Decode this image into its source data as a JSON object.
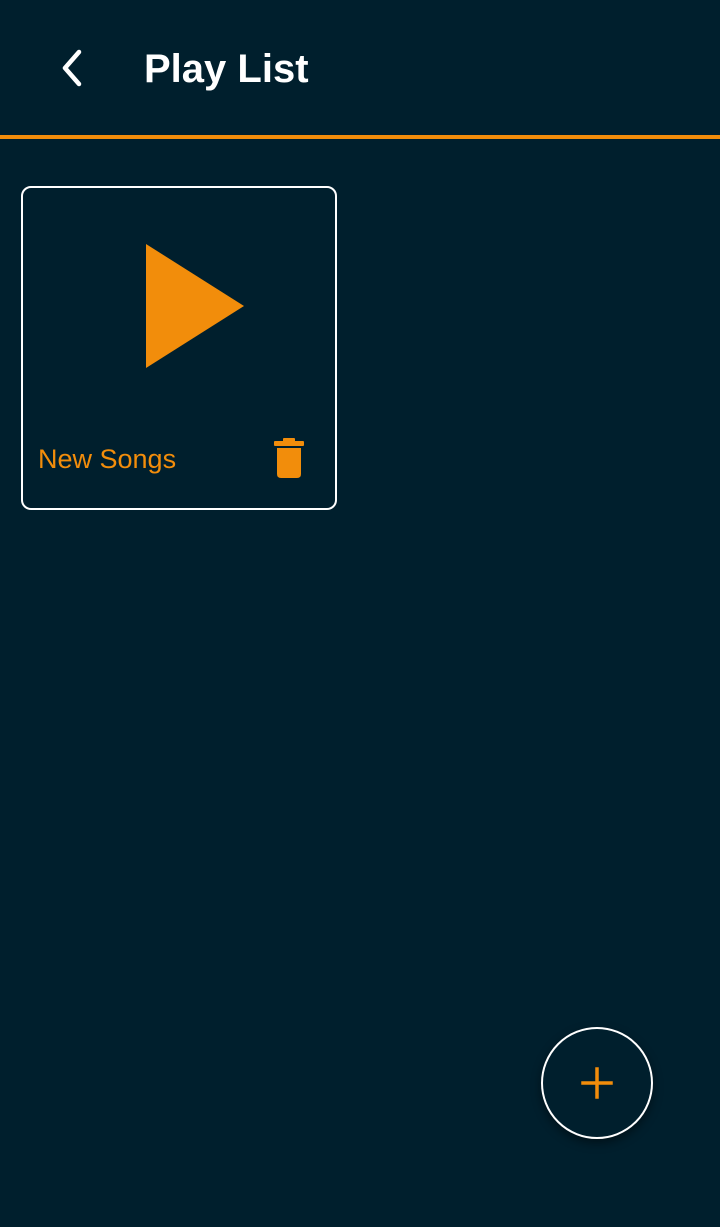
{
  "header": {
    "title": "Play List",
    "back_icon": "chevron-left-icon"
  },
  "playlists": [
    {
      "name": "New Songs",
      "cover_icon": "play-icon",
      "action_icon": "trash-icon"
    }
  ],
  "fab": {
    "icon": "plus-icon"
  },
  "colors": {
    "background": "#001f2d",
    "accent": "#f28d0b",
    "text_primary": "#ffffff",
    "border": "#ffffff"
  }
}
